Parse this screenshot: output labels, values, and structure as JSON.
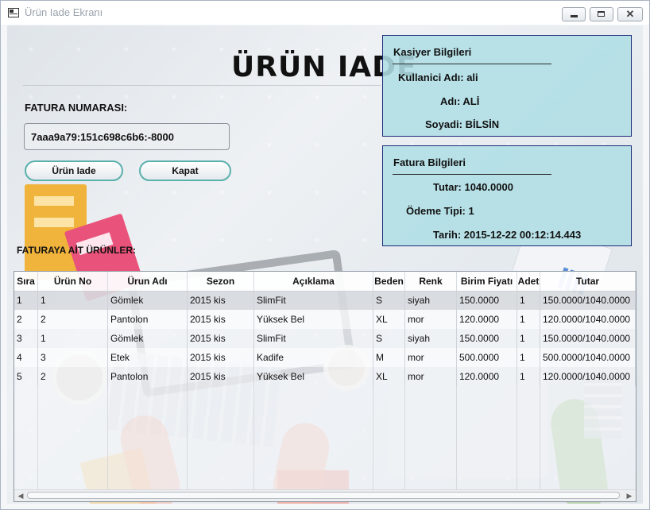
{
  "window": {
    "title": "Ürün Iade Ekranı"
  },
  "page": {
    "title": "ÜRÜN IADE"
  },
  "invoice_input": {
    "label": "FATURA NUMARASI:",
    "value": "7aaa9a79:151c698c6b6:-8000"
  },
  "buttons": {
    "return_label": "Ürün Iade",
    "close_label": "Kapat"
  },
  "cashier_panel": {
    "title": "Kasiyer Bilgileri",
    "username": "Kullanici Adı: ali",
    "name": "Adı: ALİ",
    "surname": "Soyadi: BİLSİN"
  },
  "invoice_panel": {
    "title": "Fatura Bilgileri",
    "total": "Tutar: 1040.0000",
    "payment_type": "Ödeme Tipi: 1",
    "date": "Tarih: 2015-12-22 00:12:14.443"
  },
  "products_label": "FATURAYA AİT ÜRÜNLER:",
  "table": {
    "columns": [
      "Sıra",
      "Ürün No",
      "Ürun Adı",
      "Sezon",
      "Açıklama",
      "Beden",
      "Renk",
      "Birim Fiyatı",
      "Adet",
      "Tutar"
    ],
    "rows": [
      [
        "1",
        "1",
        "Gömlek",
        "2015 kis",
        "SlimFit",
        "S",
        "siyah",
        "150.0000",
        "1",
        "150.0000/1040.0000"
      ],
      [
        "2",
        "2",
        "Pantolon",
        "2015 kis",
        "Yüksek Bel",
        "XL",
        "mor",
        "120.0000",
        "1",
        "120.0000/1040.0000"
      ],
      [
        "3",
        "1",
        "Gömlek",
        "2015 kis",
        "SlimFit",
        "S",
        "siyah",
        "150.0000",
        "1",
        "150.0000/1040.0000"
      ],
      [
        "4",
        "3",
        "Etek",
        "2015 kis",
        "Kadife",
        "M",
        "mor",
        "500.0000",
        "1",
        "500.0000/1040.0000"
      ],
      [
        "5",
        "2",
        "Pantolon",
        "2015 kis",
        "Yüksek Bel",
        "XL",
        "mor",
        "120.0000",
        "1",
        "120.0000/1040.0000"
      ]
    ],
    "selected_row_index": 0
  },
  "icons": {
    "app": "window-app-icon",
    "minimize": "minimize-icon",
    "maximize": "maximize-icon",
    "close": "close-icon",
    "close_glyph": "✕",
    "scroll_left": "◀",
    "scroll_right": "▶"
  },
  "colors": {
    "panel_fill": "#afdee5",
    "panel_border": "#1d2a78",
    "button_border": "#5bb0ad"
  }
}
